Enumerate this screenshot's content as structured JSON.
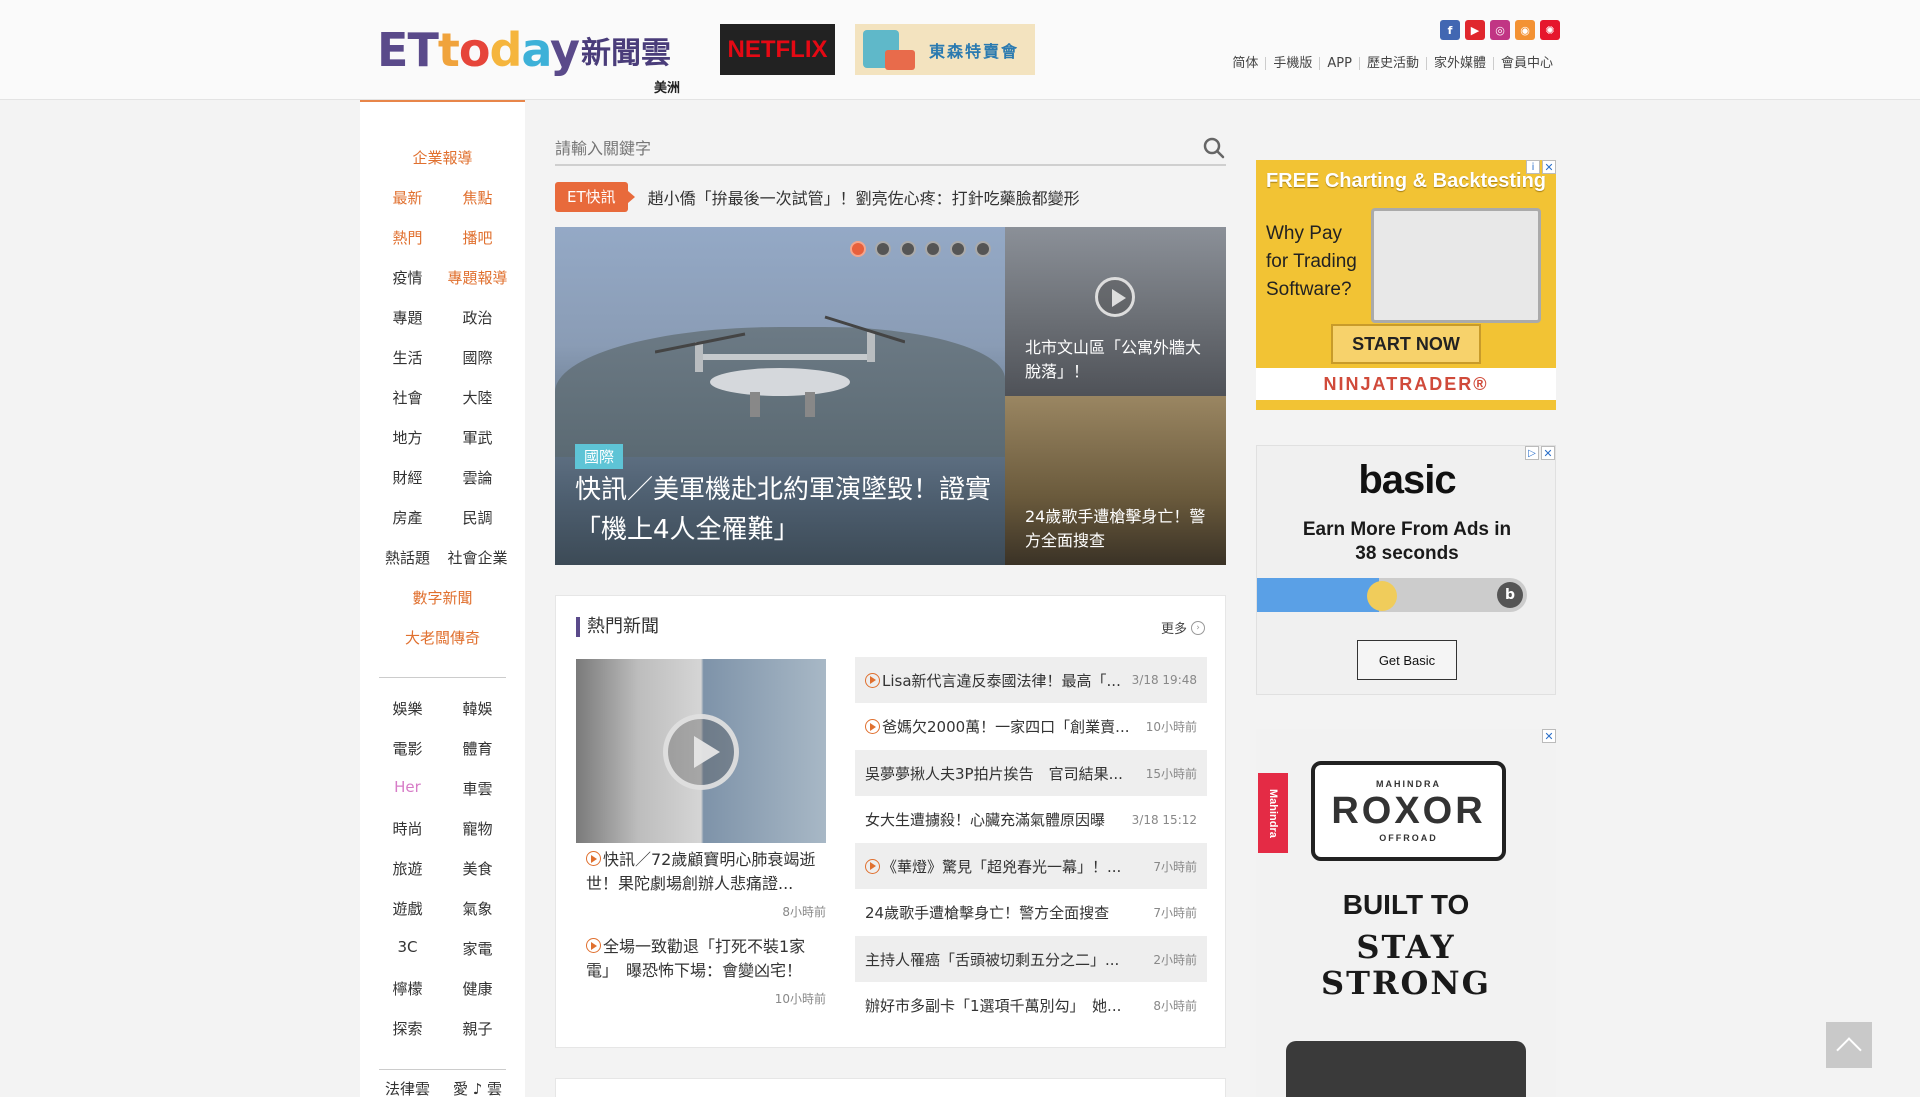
{
  "header": {
    "logo_text": "ETtoday新聞雲",
    "region": "美洲",
    "netflix_ad": "NETFLIX",
    "tokyo_ad": "東森特賣會",
    "social": [
      {
        "name": "facebook-icon",
        "glyph": "f",
        "color": "#4267b2"
      },
      {
        "name": "youtube-icon",
        "glyph": "▶",
        "color": "#e0272d"
      },
      {
        "name": "instagram-icon",
        "glyph": "◎",
        "color": "#c13584"
      },
      {
        "name": "rss-icon",
        "glyph": "◉",
        "color": "#f39233"
      },
      {
        "name": "weibo-icon",
        "glyph": "✺",
        "color": "#e6162d"
      }
    ],
    "topnav": [
      "简体",
      "手機版",
      "APP",
      "歷史活動",
      "家外媒體",
      "會員中心"
    ]
  },
  "sidebar": {
    "rows": [
      [
        "企業報導"
      ],
      [
        "最新",
        "焦點"
      ],
      [
        "熱門",
        "播吧"
      ],
      [
        "疫情",
        "專題報導"
      ],
      [
        "專題",
        "政治"
      ],
      [
        "生活",
        "國際"
      ],
      [
        "社會",
        "大陸"
      ],
      [
        "地方",
        "軍武"
      ],
      [
        "財經",
        "雲論"
      ],
      [
        "房產",
        "民調"
      ],
      [
        "熱話題",
        "社會企業"
      ],
      [
        "數字新聞"
      ],
      [
        "大老闆傳奇"
      ],
      [
        "娛樂",
        "韓娛"
      ],
      [
        "電影",
        "體育"
      ],
      [
        "Her",
        "車雲"
      ],
      [
        "時尚",
        "寵物"
      ],
      [
        "旅遊",
        "美食"
      ],
      [
        "遊戲",
        "氣象"
      ],
      [
        "3C",
        "家電"
      ],
      [
        "檸檬",
        "健康"
      ],
      [
        "探索",
        "親子"
      ],
      [
        "法律雲",
        "愛 ♪ 雲"
      ]
    ]
  },
  "search": {
    "placeholder": "請輸入關鍵字"
  },
  "flash": {
    "tag": "ET快訊",
    "text": "趙小僑「拚最後一次試管」！劉亮佐心疼：打針吃藥臉都變形"
  },
  "hero": {
    "category": "國際",
    "title": "快訊／美軍機赴北約軍演墜毀！證實「機上4人全罹難」",
    "side": [
      {
        "caption": "北市文山區「公寓外牆大脫落」！"
      },
      {
        "caption": "24歲歌手遭槍擊身亡！警方全面搜查"
      }
    ]
  },
  "hot": {
    "title": "熱門新聞",
    "more": "更多",
    "left": [
      {
        "title": "快訊／72歲顧寶明心肺衰竭逝世！果陀劇場創辦人悲痛證...",
        "time": "8小時前"
      },
      {
        "title": "全場一致勸退「打死不裝1家電」　曝恐怖下場：會變凶宅！",
        "time": "10小時前"
      }
    ],
    "right": [
      {
        "title": "Lisa新代言違反泰國法律！最高「...",
        "time": "3/18 19:48",
        "video": true
      },
      {
        "title": "爸媽欠2000萬！一家四口「創業賣...",
        "time": "10小時前",
        "video": true
      },
      {
        "title": "吳夢夢揪人夫3P拍片挨告　官司結果...",
        "time": "15小時前",
        "video": false
      },
      {
        "title": "女大生遭擄殺！心臟充滿氣體原因曝",
        "time": "3/18 15:12",
        "video": false
      },
      {
        "title": "《華燈》驚見「超兇春光一幕」！...",
        "time": "7小時前",
        "video": true
      },
      {
        "title": "24歲歌手遭槍擊身亡！警方全面搜查",
        "time": "7小時前",
        "video": false
      },
      {
        "title": "主持人罹癌「舌頭被切剩五分之二」...",
        "time": "2小時前",
        "video": false
      },
      {
        "title": "辦好市多副卡「1選項千萬別勾」　她...",
        "time": "8小時前",
        "video": false
      }
    ]
  },
  "ads": {
    "ninja": {
      "headline": "FREE Charting & Backtesting",
      "body": "Why Pay for Trading Software?",
      "cta": "START NOW",
      "brand": "NINJATRADER®"
    },
    "basic": {
      "brand": "basic",
      "message": "Earn More From Ads in 38 seconds",
      "cta": "Get Basic",
      "progress": 0.45
    },
    "roxor": {
      "side": "Mahindra",
      "brand_top": "MAHINDRA",
      "brand": "ROXOR",
      "brand_bottom": "OFFROAD",
      "line1": "BUILT TO",
      "line2": "STAY STRONG"
    }
  }
}
